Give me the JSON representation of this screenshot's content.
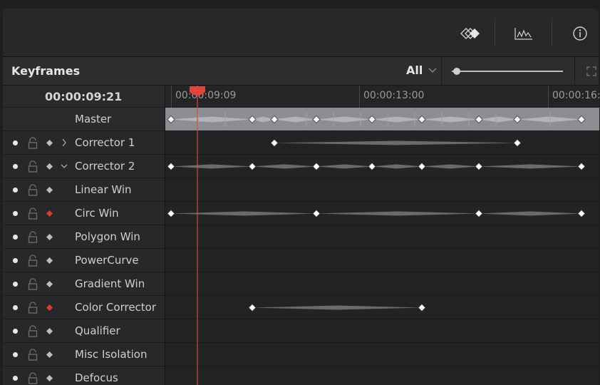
{
  "toolbar": {
    "icons": [
      "keyframes-mode-icon",
      "curve-graph-icon",
      "info-icon"
    ]
  },
  "panel": {
    "title": "Keyframes",
    "filter": "All"
  },
  "timecode": "00:00:09:21",
  "ruler": {
    "labels": [
      "00:00:09:09",
      "00:00:13:00",
      "00:00:16:"
    ]
  },
  "colors": {
    "playhead": "#e0443a",
    "keyframe_active": "#e03a2e",
    "keyframe": "#d0d0d0",
    "ramp": "#6b6b6e",
    "master_lane": "#8e8e92"
  },
  "tracks": [
    {
      "label": "Master",
      "type": "master"
    },
    {
      "label": "Corrector 1",
      "keyframe_icon": "diamond",
      "expander": "collapsed"
    },
    {
      "label": "Corrector 2",
      "keyframe_icon": "diamond",
      "expander": "expanded"
    },
    {
      "label": "Linear Win",
      "keyframe_icon": "diamond"
    },
    {
      "label": "Circ Win",
      "keyframe_icon": "diamond-red"
    },
    {
      "label": "Polygon Win",
      "keyframe_icon": "diamond"
    },
    {
      "label": "PowerCurve",
      "keyframe_icon": "diamond"
    },
    {
      "label": "Gradient Win",
      "keyframe_icon": "diamond"
    },
    {
      "label": "Color Corrector",
      "keyframe_icon": "diamond-red"
    },
    {
      "label": "Qualifier",
      "keyframe_icon": "diamond"
    },
    {
      "label": "Misc Isolation",
      "keyframe_icon": "diamond"
    },
    {
      "label": "Defocus",
      "keyframe_icon": "diamond"
    }
  ]
}
